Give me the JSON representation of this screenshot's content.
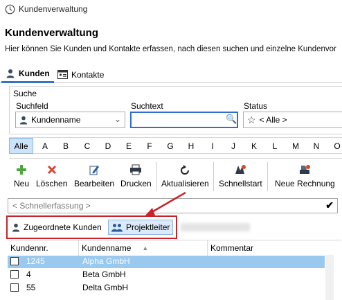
{
  "window": {
    "title": "Kundenverwaltung"
  },
  "header": {
    "heading": "Kundenverwaltung",
    "description": "Hier können Sie Kunden und Kontakte erfassen, nach diesen suchen und einzelne Kundenvor"
  },
  "tabs": [
    {
      "label": "Kunden",
      "active": true,
      "icon": "person-icon"
    },
    {
      "label": "Kontakte",
      "active": false,
      "icon": "contact-card-icon"
    }
  ],
  "search": {
    "group_label": "Suche",
    "field_label": "Suchfeld",
    "field_value": "Kundenname",
    "text_label": "Suchtext",
    "text_value": "",
    "status_label": "Status",
    "status_value": "< Alle >"
  },
  "letters": [
    "Alle",
    "A",
    "B",
    "C",
    "D",
    "E",
    "F",
    "G",
    "H",
    "I",
    "J",
    "K",
    "L",
    "M",
    "N",
    "O"
  ],
  "active_letter": "Alle",
  "toolbar": {
    "new": "Neu",
    "delete": "Löschen",
    "edit": "Bearbeiten",
    "print": "Drucken",
    "refresh": "Aktualisieren",
    "quickstart": "Schnellstart",
    "new_invoice": "Neue Rechnung"
  },
  "quick_entry": {
    "placeholder": "< Schnellerfassung >"
  },
  "filters": {
    "assigned": "Zugeordnete Kunden",
    "project_lead": "Projektleiter"
  },
  "table": {
    "columns": [
      "Kundennr.",
      "Kundenname",
      "Kommentar"
    ],
    "rows": [
      {
        "nr": "1245",
        "name": "Alpha GmbH",
        "comment": "",
        "selected": true
      },
      {
        "nr": "4",
        "name": "Beta GmbH",
        "comment": "",
        "selected": false
      },
      {
        "nr": "55",
        "name": "Delta GmbH",
        "comment": "",
        "selected": false
      }
    ]
  },
  "colors": {
    "accent": "#3574c4",
    "selection": "#99c9ef",
    "annotation": "#c8232c"
  }
}
